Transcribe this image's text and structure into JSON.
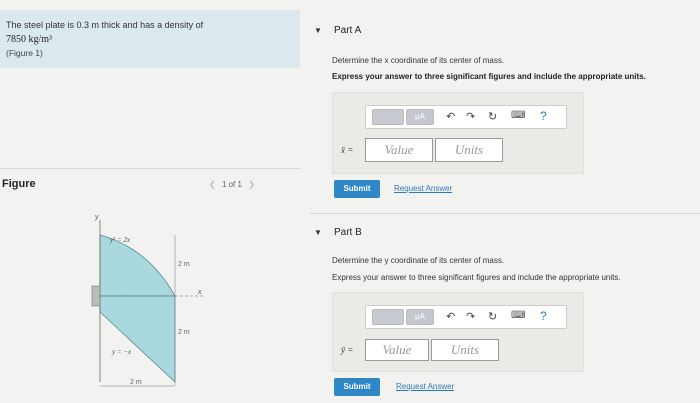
{
  "problem": {
    "line1": "The steel plate is 0.3 m thick and has a density of",
    "line2": "7850 kg/m³",
    "line3": "(Figure 1)"
  },
  "figure": {
    "label": "Figure",
    "pager": "1 of 1",
    "prev_icon": "chevron-left-icon",
    "next_icon": "chevron-right-icon",
    "labels": {
      "curve1": "y² = 2x",
      "curve2": "y = −x",
      "dim_top": "2 m",
      "dim_mid": "2 m",
      "dim_bottom": "2 m",
      "x_axis": "x",
      "y_axis": "y"
    }
  },
  "partA": {
    "title": "Part A",
    "instruction": "Determine the x coordinate of its center of mass.",
    "instruction2": "Express your answer to three significant figures and include the appropriate units.",
    "var_label": "x̄ =",
    "value_placeholder": "Value",
    "units_placeholder": "Units",
    "submit": "Submit",
    "request": "Request Answer",
    "mu_label": "μA",
    "help_label": "?"
  },
  "partB": {
    "title": "Part B",
    "instruction": "Determine the y coordinate of its center of mass.",
    "instruction2": "Express your answer to three significant figures and include the appropriate units.",
    "var_label": "ȳ =",
    "value_placeholder": "Value",
    "units_placeholder": "Units",
    "submit": "Submit",
    "request": "Request Answer",
    "mu_label": "μA",
    "help_label": "?"
  },
  "colors": {
    "plate": "#a9d8de",
    "submit": "#2f86c7",
    "link": "#2f79b8",
    "problem_bg": "#dbe9ee"
  }
}
